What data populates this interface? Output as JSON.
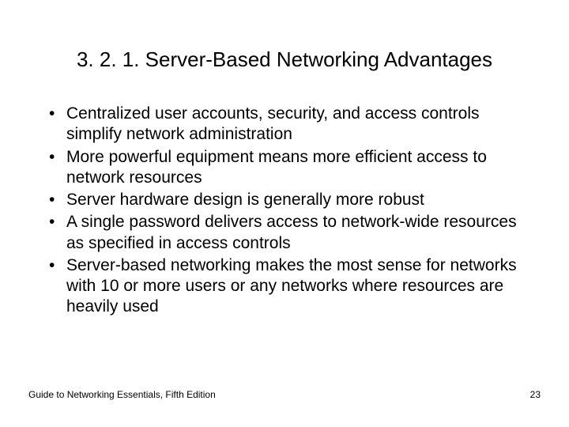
{
  "title": "3. 2. 1. Server-Based Networking Advantages",
  "bullets": [
    "Centralized user accounts, security, and access controls simplify network administration",
    "More powerful equipment means more efficient access to network resources",
    "Server hardware design is generally more robust",
    "A single password delivers access to network-wide resources as specified in access controls",
    "Server-based networking makes the most sense for networks with 10 or more users or any networks where resources are heavily used"
  ],
  "footer": {
    "source": "Guide to Networking Essentials, Fifth Edition",
    "page": "23"
  }
}
